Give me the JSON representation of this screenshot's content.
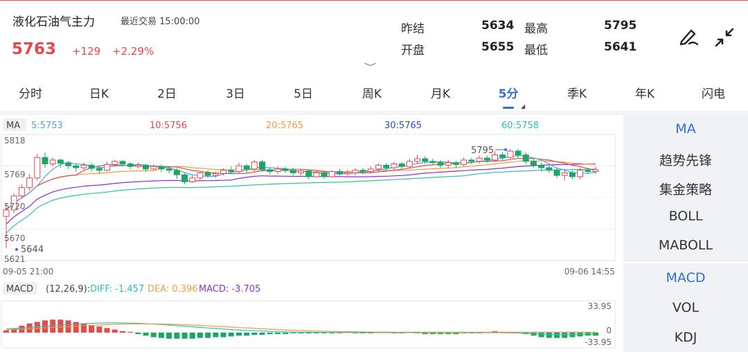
{
  "header": {
    "title": "液化石油气主力",
    "recent_trade": "最近交易  15:00:00",
    "price": "5763",
    "change": "+129",
    "change_pct": "+2.29%"
  },
  "quote": {
    "prev_settle_label": "昨结",
    "prev_settle": "5634",
    "open_label": "开盘",
    "open": "5655",
    "high_label": "最高",
    "high": "5795",
    "low_label": "最低",
    "low": "5641"
  },
  "tabs": [
    "分时",
    "日K",
    "2日",
    "3日",
    "5日",
    "周K",
    "月K",
    "5分",
    "季K",
    "年K",
    "闪电"
  ],
  "active_tab": "5分",
  "ma_bar": {
    "badge": "MA",
    "ma5": "5:5753",
    "ma10": "10:5756",
    "ma20": "20:5765",
    "ma30": "30:5765",
    "ma60": "60:5758"
  },
  "price_axis": {
    "top": "5818",
    "mid": "5769",
    "low1": "5720",
    "low2": "5670",
    "bottom": "5621",
    "max_mark": "5795",
    "min_mark": "5644"
  },
  "time_axis": {
    "start": "09-05 21:00",
    "end": "09-06 14:55"
  },
  "macd_bar": {
    "badge": "MACD",
    "params": "(12,26,9):",
    "diff": "DIFF: -1.457",
    "dea": "DEA: 0.396",
    "macd": "MACD: -3.705",
    "axis_top": "33.95",
    "axis_zero": "0",
    "axis_bottom": "-33.95"
  },
  "side_main": [
    "MA",
    "趋势先锋",
    "集金策略",
    "BOLL",
    "MABOLL"
  ],
  "side_sub": [
    "MACD",
    "VOL",
    "KDJ"
  ],
  "colors": {
    "up": "#e5484d",
    "down": "#1aa764",
    "accent": "#2f6fd6",
    "ma5": "#4aa6e8",
    "ma10": "#e5484d",
    "ma20": "#f29b3a",
    "ma30": "#2e4fb5",
    "ma60": "#2bc2b1",
    "purple": "#8a2be2"
  },
  "chart_data": {
    "type": "candlestick",
    "ylim": [
      5621,
      5818
    ],
    "candles": [
      [
        5690,
        5700,
        5640,
        5710
      ],
      [
        5700,
        5722,
        5695,
        5726
      ],
      [
        5722,
        5735,
        5718,
        5740
      ],
      [
        5735,
        5750,
        5730,
        5756
      ],
      [
        5750,
        5782,
        5746,
        5788
      ],
      [
        5782,
        5772,
        5766,
        5790
      ],
      [
        5772,
        5778,
        5768,
        5782
      ],
      [
        5778,
        5773,
        5766,
        5780
      ],
      [
        5773,
        5769,
        5764,
        5776
      ],
      [
        5769,
        5766,
        5760,
        5773
      ],
      [
        5766,
        5770,
        5762,
        5774
      ],
      [
        5770,
        5765,
        5760,
        5773
      ],
      [
        5765,
        5762,
        5756,
        5769
      ],
      [
        5762,
        5771,
        5760,
        5775
      ],
      [
        5771,
        5776,
        5768,
        5778
      ],
      [
        5776,
        5772,
        5768,
        5778
      ],
      [
        5772,
        5768,
        5764,
        5775
      ],
      [
        5768,
        5770,
        5765,
        5774
      ],
      [
        5770,
        5764,
        5760,
        5772
      ],
      [
        5764,
        5768,
        5762,
        5771
      ],
      [
        5768,
        5764,
        5759,
        5771
      ],
      [
        5764,
        5762,
        5757,
        5768
      ],
      [
        5762,
        5755,
        5748,
        5765
      ],
      [
        5755,
        5744,
        5740,
        5758
      ],
      [
        5744,
        5750,
        5742,
        5754
      ],
      [
        5750,
        5758,
        5746,
        5760
      ],
      [
        5758,
        5754,
        5750,
        5762
      ],
      [
        5754,
        5757,
        5750,
        5760
      ],
      [
        5757,
        5762,
        5754,
        5765
      ],
      [
        5762,
        5760,
        5756,
        5768
      ],
      [
        5760,
        5769,
        5757,
        5774
      ],
      [
        5769,
        5764,
        5758,
        5772
      ],
      [
        5764,
        5775,
        5760,
        5778
      ],
      [
        5775,
        5763,
        5760,
        5778
      ],
      [
        5763,
        5760,
        5756,
        5766
      ],
      [
        5760,
        5764,
        5756,
        5768
      ],
      [
        5764,
        5762,
        5758,
        5767
      ],
      [
        5762,
        5758,
        5754,
        5766
      ],
      [
        5758,
        5761,
        5754,
        5764
      ],
      [
        5761,
        5752,
        5748,
        5763
      ],
      [
        5752,
        5758,
        5750,
        5762
      ],
      [
        5758,
        5752,
        5749,
        5760
      ],
      [
        5752,
        5760,
        5750,
        5762
      ],
      [
        5760,
        5757,
        5754,
        5764
      ],
      [
        5757,
        5758,
        5754,
        5762
      ],
      [
        5758,
        5762,
        5754,
        5765
      ],
      [
        5762,
        5760,
        5756,
        5766
      ],
      [
        5760,
        5764,
        5757,
        5768
      ],
      [
        5764,
        5770,
        5760,
        5773
      ],
      [
        5770,
        5766,
        5762,
        5773
      ],
      [
        5766,
        5772,
        5762,
        5775
      ],
      [
        5772,
        5768,
        5764,
        5775
      ],
      [
        5768,
        5776,
        5765,
        5780
      ],
      [
        5776,
        5780,
        5772,
        5786
      ],
      [
        5780,
        5776,
        5772,
        5784
      ],
      [
        5776,
        5774,
        5770,
        5780
      ],
      [
        5774,
        5770,
        5766,
        5778
      ],
      [
        5770,
        5774,
        5766,
        5778
      ],
      [
        5774,
        5771,
        5766,
        5777
      ],
      [
        5771,
        5778,
        5768,
        5782
      ],
      [
        5778,
        5776,
        5772,
        5781
      ],
      [
        5776,
        5781,
        5772,
        5785
      ],
      [
        5781,
        5778,
        5774,
        5785
      ],
      [
        5778,
        5786,
        5775,
        5792
      ],
      [
        5786,
        5782,
        5778,
        5790
      ],
      [
        5782,
        5792,
        5780,
        5795
      ],
      [
        5792,
        5786,
        5780,
        5795
      ],
      [
        5786,
        5776,
        5772,
        5790
      ],
      [
        5776,
        5770,
        5766,
        5780
      ],
      [
        5770,
        5766,
        5760,
        5774
      ],
      [
        5766,
        5762,
        5758,
        5770
      ],
      [
        5762,
        5754,
        5750,
        5766
      ],
      [
        5754,
        5758,
        5746,
        5762
      ],
      [
        5758,
        5752,
        5748,
        5762
      ],
      [
        5752,
        5762,
        5748,
        5766
      ],
      [
        5762,
        5760,
        5756,
        5766
      ],
      [
        5760,
        5763,
        5756,
        5768
      ]
    ]
  }
}
